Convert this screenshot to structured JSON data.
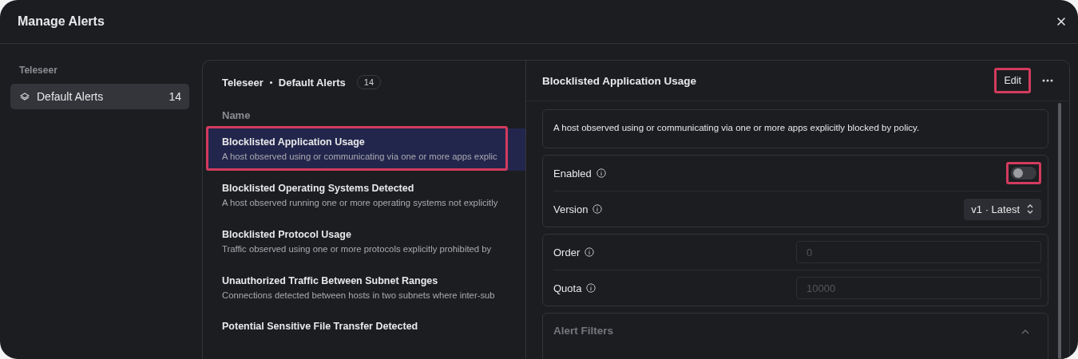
{
  "window": {
    "title": "Manage Alerts"
  },
  "sidebar": {
    "group": "Teleseer",
    "items": [
      {
        "label": "Default Alerts",
        "count": "14",
        "selected": true
      }
    ]
  },
  "list": {
    "breadcrumb": [
      "Teleseer",
      "Default Alerts"
    ],
    "count": "14",
    "column": "Name",
    "items": [
      {
        "title": "Blocklisted Application Usage",
        "description": "A host observed using or communicating via one or more apps explic",
        "selected": true,
        "highlighted": true
      },
      {
        "title": "Blocklisted Operating Systems Detected",
        "description": "A host observed running one or more operating systems not explicitly",
        "selected": false,
        "highlighted": false
      },
      {
        "title": "Blocklisted Protocol Usage",
        "description": "Traffic observed using one or more protocols explicitly prohibited by",
        "selected": false,
        "highlighted": false
      },
      {
        "title": "Unauthorized Traffic Between Subnet Ranges",
        "description": "Connections detected between hosts in two subnets where inter-sub",
        "selected": false,
        "highlighted": false
      },
      {
        "title": "Potential Sensitive File Transfer Detected",
        "selected": false,
        "highlighted": false
      }
    ]
  },
  "detail": {
    "title": "Blocklisted Application Usage",
    "edit_button": {
      "label": "Edit",
      "highlighted": true
    },
    "description": "A host observed using or communicating via one or more apps explicitly blocked by policy.",
    "enabled": {
      "label": "Enabled",
      "on": false,
      "highlighted": true
    },
    "version": {
      "label": "Version",
      "value": "v1 · Latest"
    },
    "order": {
      "label": "Order",
      "placeholder": "0"
    },
    "quota": {
      "label": "Quota",
      "placeholder": "10000"
    },
    "filters": {
      "label": "Alert Filters",
      "expanded": true
    }
  }
}
